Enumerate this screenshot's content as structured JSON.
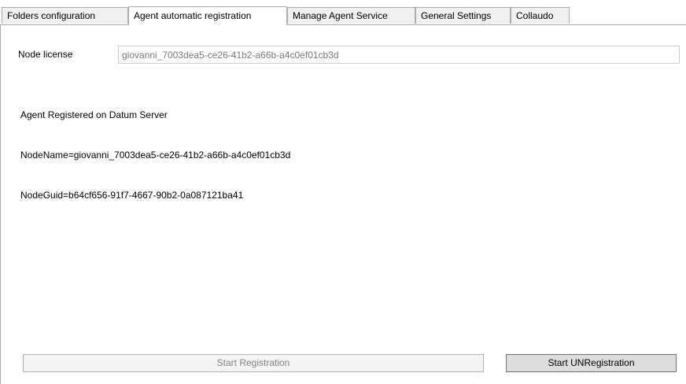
{
  "tabs": [
    {
      "label": "Folders configuration",
      "selected": false
    },
    {
      "label": "Agent automatic registration",
      "selected": true
    },
    {
      "label": "Manage Agent Service",
      "selected": false
    },
    {
      "label": "General Settings",
      "selected": false
    },
    {
      "label": "Collaudo",
      "selected": false
    }
  ],
  "license": {
    "label": "Node license",
    "value": "giovanni_7003dea5-ce26-41b2-a66b-a4c0ef01cb3d"
  },
  "status": {
    "line1": "Agent Registered on Datum Server",
    "line2": "NodeName=giovanni_7003dea5-ce26-41b2-a66b-a4c0ef01cb3d",
    "line3": "NodeGuid=b64cf656-91f7-4667-90b2-0a087121ba41"
  },
  "buttons": {
    "start_registration": "Start Registration",
    "start_unregistration": "Start UNRegistration"
  }
}
